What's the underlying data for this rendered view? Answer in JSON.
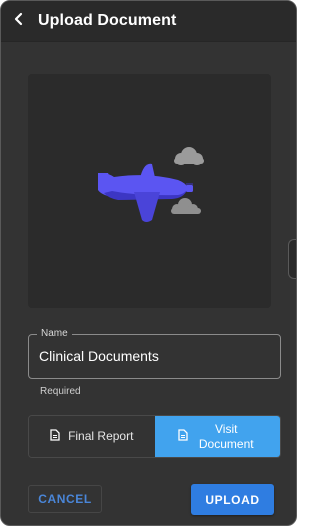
{
  "header": {
    "title": "Upload Document",
    "back_icon": "chevron-left-icon"
  },
  "illustration": {
    "icons": [
      "airplane-icon",
      "cloud-icon"
    ],
    "colors": {
      "plane": "#5b55f2",
      "plane_dark": "#3c36c4",
      "cloud": "#9b9b9b"
    }
  },
  "name_field": {
    "label": "Name",
    "value": "Clinical Documents",
    "helper": "Required"
  },
  "document_type": {
    "options": [
      {
        "label": "Final Report",
        "icon": "document-icon",
        "selected": false
      },
      {
        "label": "Visit Document",
        "icon": "document-icon",
        "selected": true
      }
    ]
  },
  "actions": {
    "cancel_label": "CANCEL",
    "upload_label": "UPLOAD"
  },
  "colors": {
    "accent": "#41a3ee",
    "primary_button": "#2f7de1",
    "text_button": "#4a86d8"
  }
}
